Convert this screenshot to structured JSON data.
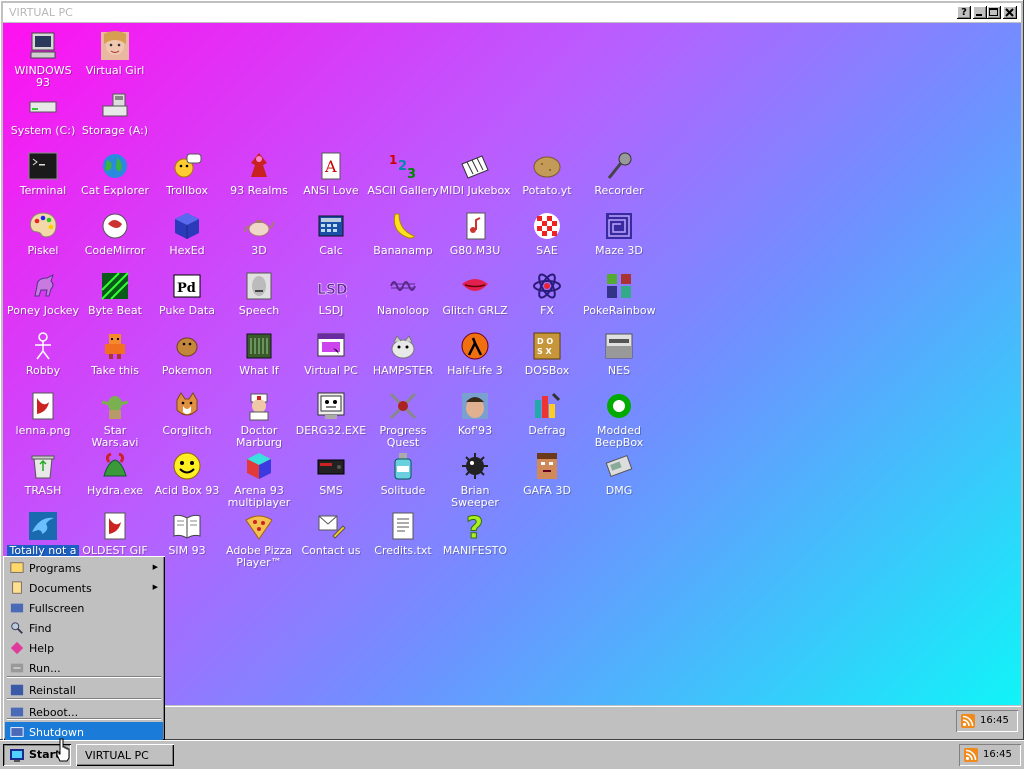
{
  "window": {
    "title": "VIRTUAL PC",
    "btn_help": "?"
  },
  "colors": {
    "gradient_start": "#ff10f0",
    "gradient_end": "#10f4f8",
    "selection": "#1b5fc5",
    "menu_highlight": "#1b7bd8"
  },
  "desktop": {
    "icons": [
      {
        "label": "WINDOWS 93",
        "icon": "computer-icon"
      },
      {
        "label": "Virtual Girl",
        "icon": "face-icon"
      },
      {
        "label": "System (C:)",
        "icon": "hard-drive-icon"
      },
      {
        "label": "Storage (A:)",
        "icon": "floppy-drive-icon"
      },
      {
        "label": "Terminal",
        "icon": "terminal-icon"
      },
      {
        "label": "Cat Explorer",
        "icon": "globe-icon"
      },
      {
        "label": "Trollbox",
        "icon": "chat-icon"
      },
      {
        "label": "93 Realms",
        "icon": "realms-icon"
      },
      {
        "label": "ANSI Love",
        "icon": "ansi-icon"
      },
      {
        "label": "ASCII Gallery",
        "icon": "ascii-icon"
      },
      {
        "label": "MIDI Jukebox",
        "icon": "piano-icon"
      },
      {
        "label": "Potato.yt",
        "icon": "potato-icon"
      },
      {
        "label": "Recorder",
        "icon": "microphone-icon"
      },
      {
        "label": "Piskel",
        "icon": "palette-icon"
      },
      {
        "label": "CodeMirror",
        "icon": "codemirror-icon"
      },
      {
        "label": "HexEd",
        "icon": "cube-icon"
      },
      {
        "label": "3D",
        "icon": "teapot-icon"
      },
      {
        "label": "Calc",
        "icon": "calculator-icon"
      },
      {
        "label": "Bananamp",
        "icon": "banana-icon"
      },
      {
        "label": "G80.M3U",
        "icon": "playlist-icon"
      },
      {
        "label": "SAE",
        "icon": "amiga-ball-icon"
      },
      {
        "label": "Maze 3D",
        "icon": "maze-icon"
      },
      {
        "label": "Poney Jockey",
        "icon": "pony-icon"
      },
      {
        "label": "Byte Beat",
        "icon": "bytebeat-icon"
      },
      {
        "label": "Puke Data",
        "icon": "puredata-icon"
      },
      {
        "label": "Speech",
        "icon": "speech-icon"
      },
      {
        "label": "LSDJ",
        "icon": "lsdj-icon"
      },
      {
        "label": "Nanoloop",
        "icon": "waveform-icon"
      },
      {
        "label": "Glitch GRLZ",
        "icon": "lips-icon"
      },
      {
        "label": "FX",
        "icon": "atom-icon"
      },
      {
        "label": "PokeRainbow",
        "icon": "pokemon-icon"
      },
      {
        "label": "Robby",
        "icon": "stick-figure-icon"
      },
      {
        "label": "Take this",
        "icon": "pixel-character-icon"
      },
      {
        "label": "Pokemon",
        "icon": "pokemon-ball-icon"
      },
      {
        "label": "What If",
        "icon": "whatif-icon"
      },
      {
        "label": "Virtual PC",
        "icon": "window-icon"
      },
      {
        "label": "HAMPSTER",
        "icon": "hamster-icon"
      },
      {
        "label": "Half-Life 3",
        "icon": "lambda-icon"
      },
      {
        "label": "DOSBox",
        "icon": "dosbox-icon"
      },
      {
        "label": "NES",
        "icon": "nes-icon"
      },
      {
        "label": "lenna.png",
        "icon": "image-file-icon"
      },
      {
        "label": "Star Wars.avi",
        "icon": "yoda-icon"
      },
      {
        "label": "Corglitch",
        "icon": "corgi-icon"
      },
      {
        "label": "Doctor Marburg",
        "icon": "doctor-icon"
      },
      {
        "label": "DERG32.EXE",
        "icon": "monitor-face-icon"
      },
      {
        "label": "Progress Quest",
        "icon": "swords-icon"
      },
      {
        "label": "Kof'93",
        "icon": "fighter-icon"
      },
      {
        "label": "Defrag",
        "icon": "defrag-icon"
      },
      {
        "label": "Modded BeepBox",
        "icon": "beepbox-icon"
      },
      {
        "label": "TRASH",
        "icon": "recycle-bin-icon"
      },
      {
        "label": "Hydra.exe",
        "icon": "hydra-icon"
      },
      {
        "label": "Acid Box 93",
        "icon": "smiley-icon"
      },
      {
        "label": "Arena 93 multiplayer",
        "icon": "arena-cube-icon"
      },
      {
        "label": "SMS",
        "icon": "console-icon"
      },
      {
        "label": "Solitude",
        "icon": "bottle-icon"
      },
      {
        "label": "Brian Sweeper",
        "icon": "mine-icon"
      },
      {
        "label": "GAFA 3D",
        "icon": "doomguy-icon"
      },
      {
        "label": "DMG",
        "icon": "gameboy-icon"
      },
      {
        "label": "Totally not a",
        "icon": "dolphin-icon",
        "selected": true
      },
      {
        "label": "OLDEST GIF",
        "icon": "gif-file-icon"
      },
      {
        "label": "SIM 93",
        "icon": "book-icon"
      },
      {
        "label": "Adobe Pizza Player™",
        "icon": "pizza-icon"
      },
      {
        "label": "Contact us",
        "icon": "contact-icon"
      },
      {
        "label": "Credits.txt",
        "icon": "text-file-icon"
      },
      {
        "label": "MANIFESTO",
        "icon": "question-mark-icon"
      }
    ]
  },
  "start_menu": {
    "items": [
      {
        "label": "Programs",
        "icon": "programs-icon",
        "submenu": true
      },
      {
        "label": "Documents",
        "icon": "documents-icon",
        "submenu": true
      },
      {
        "label": "Fullscreen",
        "icon": "fullscreen-icon"
      },
      {
        "label": "Find",
        "icon": "find-icon"
      },
      {
        "label": "Help",
        "icon": "help-icon"
      },
      {
        "label": "Run...",
        "icon": "run-icon"
      },
      {
        "label": "Reinstall",
        "icon": "reinstall-icon"
      },
      {
        "label": "Reboot...",
        "icon": "reboot-icon"
      },
      {
        "label": "Shutdown",
        "icon": "shutdown-icon",
        "highlighted": true
      }
    ]
  },
  "inner_tray": {
    "time": "16:45"
  },
  "taskbar": {
    "start_label": "Start",
    "task_label": "VIRTUAL PC",
    "time": "16:45"
  }
}
